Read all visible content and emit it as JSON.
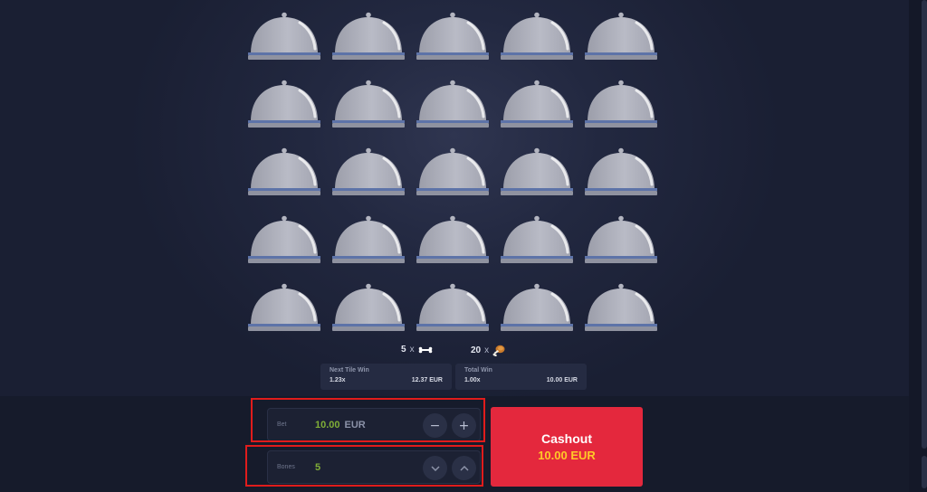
{
  "colors": {
    "accent": "#e4283d",
    "amount": "#ffc928",
    "bet_value": "#7fae37",
    "background": "#161b2b"
  },
  "grid": {
    "rows": 5,
    "columns": 5,
    "tile_icon": "cloche-icon"
  },
  "counts": {
    "bones": {
      "value": "5",
      "separator": "x",
      "icon": "bone-icon"
    },
    "food": {
      "value": "20",
      "separator": "x",
      "icon": "chicken-leg-icon"
    }
  },
  "next_tile_win": {
    "title": "Next Tile Win",
    "multiplier": "1.23x",
    "amount": "12.37 EUR"
  },
  "total_win": {
    "title": "Total Win",
    "multiplier": "1.00x",
    "amount": "10.00 EUR"
  },
  "bet": {
    "label": "Bet",
    "value": "10.00",
    "currency": "EUR",
    "decrease_icon": "minus-icon",
    "increase_icon": "plus-icon"
  },
  "bones": {
    "label": "Bones",
    "value": "5",
    "decrease_icon": "chevron-down-icon",
    "increase_icon": "chevron-up-icon"
  },
  "cashout": {
    "label": "Cashout",
    "amount": "10.00 EUR"
  }
}
